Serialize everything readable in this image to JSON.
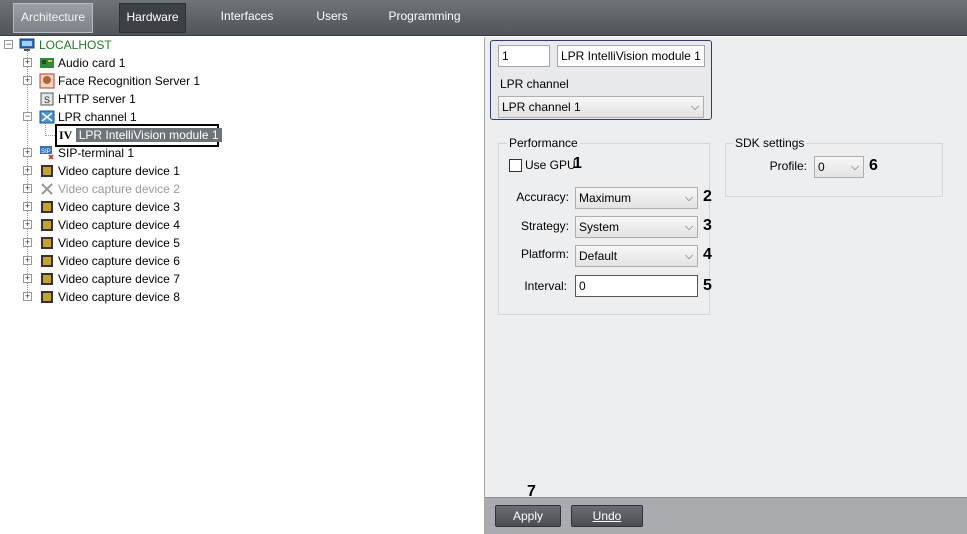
{
  "tabs": [
    "Architecture",
    "Hardware",
    "Interfaces",
    "Users",
    "Programming"
  ],
  "tree": {
    "root": "LOCALHOST",
    "items": [
      "Audio card 1",
      "Face Recognition Server 1",
      "HTTP server 1",
      "LPR channel 1",
      "LPR IntelliVision module 1",
      "SIP-terminal 1",
      "Video capture device 1",
      "Video capture device 2",
      "Video capture device 3",
      "Video capture device 4",
      "Video capture device 5",
      "Video capture device 6",
      "Video capture device 7",
      "Video capture device 8"
    ],
    "module_icon_text": "IV"
  },
  "header": {
    "id": "1",
    "name": "LPR IntelliVision module 1",
    "channel_label": "LPR channel",
    "channel_value": "LPR channel 1"
  },
  "performance": {
    "title": "Performance",
    "use_gpu": "Use GPU",
    "use_gpu_checked": false,
    "accuracy_label": "Accuracy:",
    "accuracy_value": "Maximum",
    "strategy_label": "Strategy:",
    "strategy_value": "System",
    "platform_label": "Platform:",
    "platform_value": "Default",
    "interval_label": "Interval:",
    "interval_value": "0"
  },
  "sdk": {
    "title": "SDK settings",
    "profile_label": "Profile:",
    "profile_value": "0"
  },
  "callouts": [
    "1",
    "2",
    "3",
    "4",
    "5",
    "6",
    "7"
  ],
  "buttons": {
    "apply": "Apply",
    "undo": "Undo"
  },
  "arrow_glyph": "⌵"
}
